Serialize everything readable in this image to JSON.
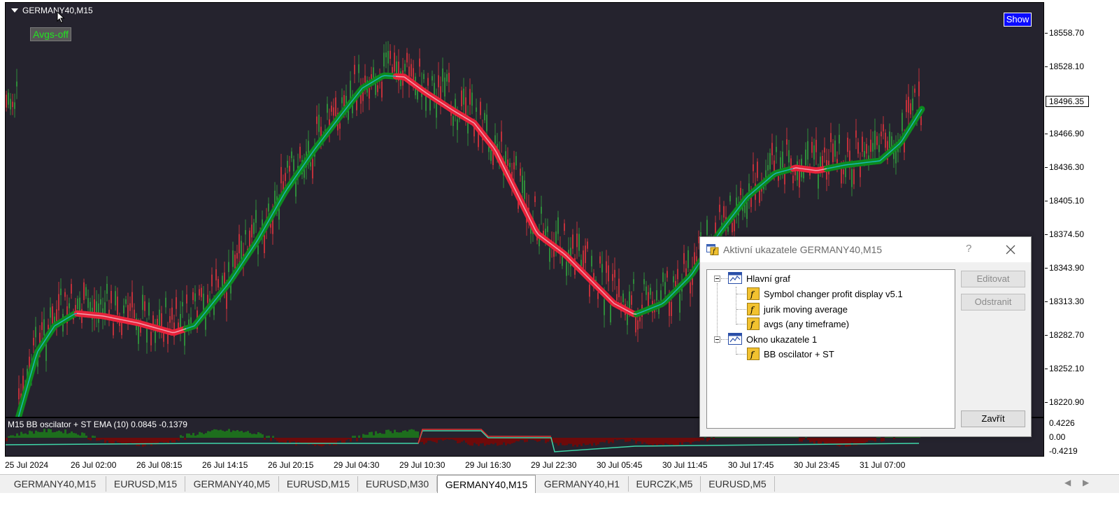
{
  "chart": {
    "symbol_title": "GERMANY40,M15",
    "avgs_button": "Avgs-off",
    "show_button": "Show",
    "colors": {
      "background": "#25232e",
      "bull": "#2e8b3a",
      "bear": "#c0303a",
      "avg_up": "#0d8a1f",
      "avg_down": "#e8223a",
      "avg_core": "#19b8b8"
    }
  },
  "subwindow": {
    "title": "M15 BB oscilator + ST EMA (10) 0.0845 -0.1379",
    "scale": [
      "0.4226",
      "0.00",
      "-0.4219"
    ]
  },
  "price_scale": {
    "labels": [
      "18558.70",
      "18528.10",
      "18466.90",
      "18436.30",
      "18405.10",
      "18374.50",
      "18343.90",
      "18313.30",
      "18282.70",
      "18252.10",
      "18220.90"
    ],
    "current": "18496.35"
  },
  "time_axis": [
    "25 Jul 2024",
    "26 Jul 02:00",
    "26 Jul 08:15",
    "26 Jul 14:15",
    "26 Jul 20:15",
    "29 Jul 04:30",
    "29 Jul 10:30",
    "29 Jul 16:30",
    "29 Jul 22:30",
    "30 Jul 05:45",
    "30 Jul 11:45",
    "30 Jul 17:45",
    "30 Jul 23:45",
    "31 Jul 07:00"
  ],
  "tabs": [
    "GERMANY40,M15",
    "EURUSD,M15",
    "GERMANY40,M5",
    "EURUSD,M15",
    "EURUSD,M30",
    "GERMANY40,M15",
    "GERMANY40,H1",
    "EURCZK,M5",
    "EURUSD,M5"
  ],
  "active_tab_index": 5,
  "dialog": {
    "title": "Aktivní ukazatele GERMANY40,M15",
    "help": "?",
    "tree": {
      "main": "Hlavní graf",
      "main_children": [
        "Symbol changer profit display v5.1",
        "jurik moving average",
        "avgs (any timeframe)"
      ],
      "sub": "Okno ukazatele 1",
      "sub_children": [
        "BB oscilator + ST"
      ]
    },
    "buttons": {
      "edit": "Editovat",
      "remove": "Odstranit",
      "close": "Zavřít"
    }
  }
}
